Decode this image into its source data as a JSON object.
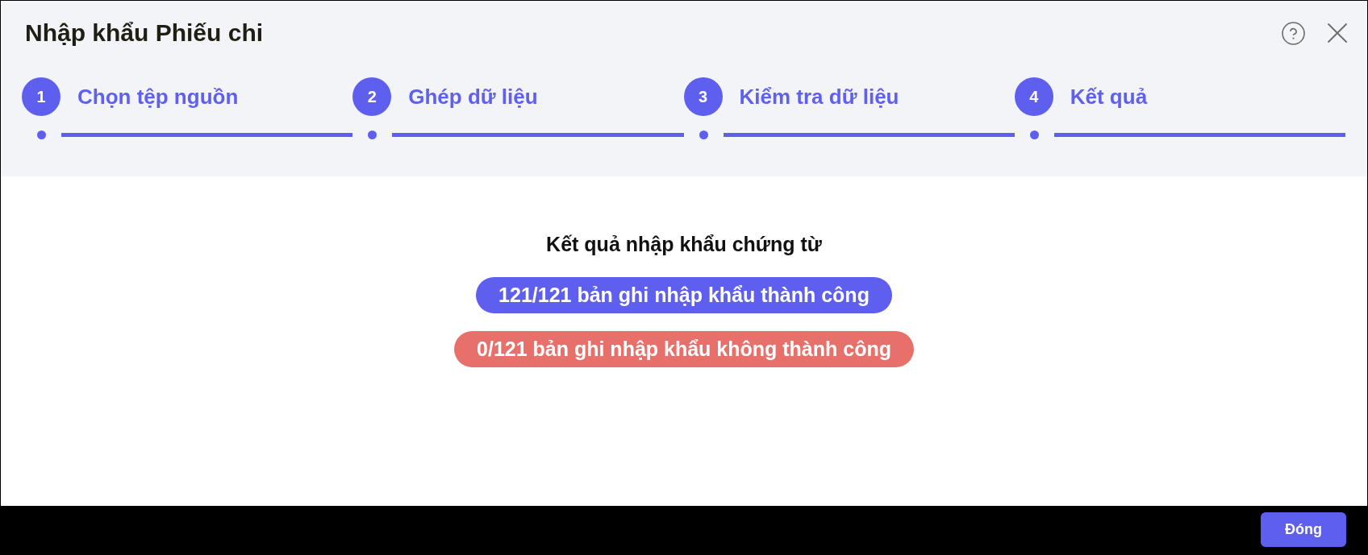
{
  "window": {
    "title": "Nhập khẩu Phiếu chi"
  },
  "steps": [
    {
      "number": "1",
      "label": "Chọn tệp nguồn",
      "completed": true
    },
    {
      "number": "2",
      "label": "Ghép dữ liệu",
      "completed": true
    },
    {
      "number": "3",
      "label": "Kiểm tra dữ liệu",
      "completed": true
    },
    {
      "number": "4",
      "label": "Kết quả",
      "completed": true
    }
  ],
  "result": {
    "heading": "Kết quả nhập khẩu chứng từ",
    "messages": [
      {
        "kind": "success",
        "text": "121/121 bản ghi nhập khẩu thành công"
      },
      {
        "kind": "failure",
        "text": "0/121 bản ghi nhập khẩu không thành công"
      }
    ]
  },
  "footer": {
    "buttons": [
      "Đóng"
    ]
  }
}
